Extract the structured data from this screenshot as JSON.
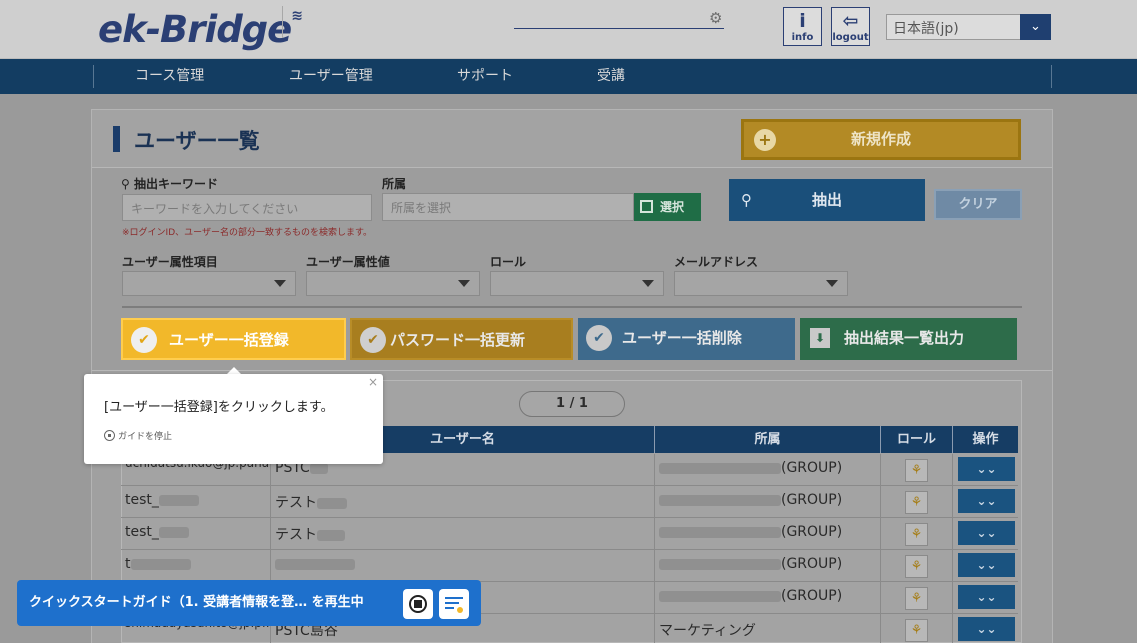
{
  "header": {
    "logo_text": "ek-Bridge",
    "info_label": "info",
    "info_glyph": "i",
    "logout_label": "logout",
    "logout_glyph": "⇦",
    "language": "日本語(jp)",
    "search_icon": "gear-icon"
  },
  "nav": {
    "items": [
      "コース管理",
      "ユーザー管理",
      "サポート",
      "受講"
    ]
  },
  "page": {
    "title": "ユーザー一覧",
    "new_button": "新規作成"
  },
  "filters": {
    "keyword_label": "抽出キーワード",
    "keyword_placeholder": "キーワードを入力してください",
    "affiliation_label": "所属",
    "affiliation_placeholder": "所属を選択",
    "select_button": "選択",
    "note": "※ログインID、ユーザー名の部分一致するものを検索します。",
    "attr_item_label": "ユーザー属性項目",
    "attr_value_label": "ユーザー属性値",
    "role_label": "ロール",
    "email_label": "メールアドレス",
    "extract_button": "抽出",
    "clear_button": "クリア"
  },
  "actions": {
    "bulk_register": "ユーザー一括登録",
    "password_update": "パスワード一括更新",
    "bulk_delete": "ユーザー一括削除",
    "export": "抽出結果一覧出力"
  },
  "pager": {
    "text": "1 / 1"
  },
  "table": {
    "headers": [
      "ユーザー名",
      "所属",
      "ロール",
      "操作"
    ],
    "rows": [
      {
        "login": "uchidatsu.ikuo@jp.pana....",
        "name": "PSTC",
        "affiliation": "(GROUP)"
      },
      {
        "login": "test_",
        "name": "テスト",
        "affiliation": "(GROUP)"
      },
      {
        "login": "test_",
        "name": "テスト",
        "affiliation": "(GROUP)"
      },
      {
        "login": "t",
        "name": "",
        "affiliation": "(GROUP)"
      },
      {
        "login": "",
        "name": "",
        "affiliation": "(GROUP)"
      },
      {
        "login": "shimadayasuhito@jp.p....",
        "name": "PSTC島谷",
        "affiliation": "マーケティング"
      }
    ]
  },
  "tooltip": {
    "message": "[ユーザー一括登録]をクリックします。",
    "stop_guide": "ガイドを停止",
    "close": "×"
  },
  "guide_bar": {
    "text": "クイックスタートガイド（1. 受講者情報を登…  を再生中"
  }
}
